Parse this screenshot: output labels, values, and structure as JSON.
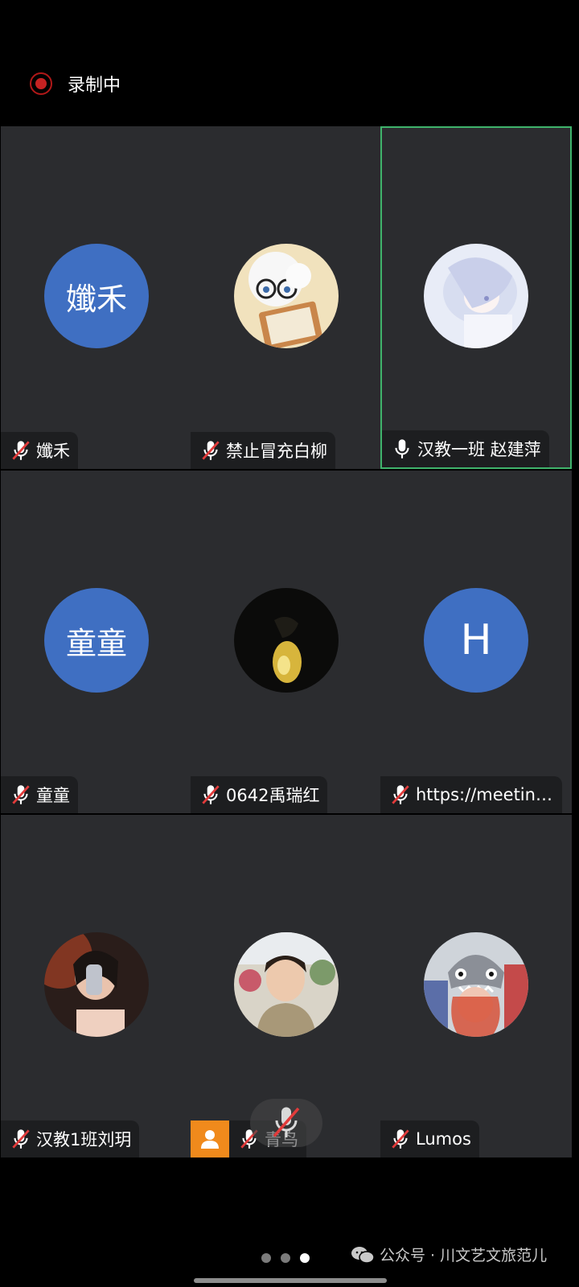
{
  "recording": {
    "label": "录制中"
  },
  "participants": [
    {
      "name": "孅禾",
      "mic": "muted",
      "avatar": {
        "type": "text",
        "text": "孅禾"
      }
    },
    {
      "name": "禁止冒充白柳",
      "mic": "muted",
      "avatar": {
        "type": "photo",
        "desc": "cartoon bear reading a book"
      }
    },
    {
      "name": "汉教一班 赵建萍",
      "mic": "on",
      "active": true,
      "avatar": {
        "type": "photo",
        "desc": "anime girl pale blue illustration"
      }
    },
    {
      "name": "童童",
      "mic": "muted",
      "avatar": {
        "type": "text",
        "text": "童童"
      }
    },
    {
      "name": "0642禹瑞红",
      "mic": "muted",
      "avatar": {
        "type": "photo",
        "desc": "dark photo with yellow light"
      }
    },
    {
      "name": "https://meeting...",
      "mic": "muted",
      "avatar": {
        "type": "text",
        "text": "H"
      }
    },
    {
      "name": "汉教1班刘玥",
      "mic": "muted",
      "avatar": {
        "type": "photo",
        "desc": "selfie with phone"
      }
    },
    {
      "name": "青鸟",
      "mic": "muted",
      "avatar": {
        "type": "photo",
        "desc": "woman in front of flowers"
      }
    },
    {
      "name": "Lumos",
      "mic": "muted",
      "avatar": {
        "type": "photo",
        "desc": "girl with shark hat"
      }
    }
  ],
  "pager": {
    "count": 3,
    "active": 2
  },
  "watermark": {
    "text": "公众号 · 川文艺文旅范儿"
  },
  "colors": {
    "avatar_blue": "#3f6fc2",
    "active_border": "#3fb36b",
    "record_red": "#c62222",
    "speaker_orange": "#f08a1c"
  }
}
